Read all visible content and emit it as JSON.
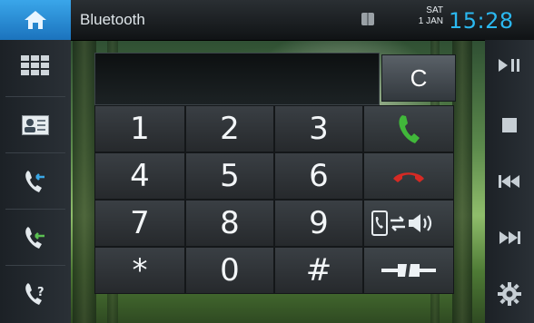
{
  "header": {
    "title": "Bluetooth",
    "day": "SAT",
    "date": "1 JAN",
    "time": "15:28",
    "icons": {
      "home": "home-icon",
      "bluetooth": "phonebook-icon"
    }
  },
  "left_sidebar": {
    "items": [
      {
        "name": "keypad-grid",
        "icon": "grid-icon"
      },
      {
        "name": "contacts",
        "icon": "contact-card-icon"
      },
      {
        "name": "call-log-incoming",
        "icon": "incoming-call-icon"
      },
      {
        "name": "call-log-outgoing",
        "icon": "outgoing-call-icon"
      },
      {
        "name": "missed-calls",
        "icon": "missed-call-icon"
      }
    ]
  },
  "right_sidebar": {
    "items": [
      {
        "name": "play-pause",
        "icon": "play-pause-icon"
      },
      {
        "name": "stop",
        "icon": "stop-icon"
      },
      {
        "name": "previous",
        "icon": "previous-icon"
      },
      {
        "name": "next",
        "icon": "next-icon"
      },
      {
        "name": "settings",
        "icon": "gear-icon"
      }
    ]
  },
  "dialer": {
    "display_value": "",
    "clear_label": "C",
    "keys": [
      "1",
      "2",
      "3",
      "4",
      "5",
      "6",
      "7",
      "8",
      "9",
      "*",
      "0",
      "#"
    ]
  },
  "colors": {
    "accent": "#2bb8f0",
    "home_blue": "#1f7fc7",
    "call_green": "#3fb63a",
    "hangup_red": "#d52a25"
  }
}
